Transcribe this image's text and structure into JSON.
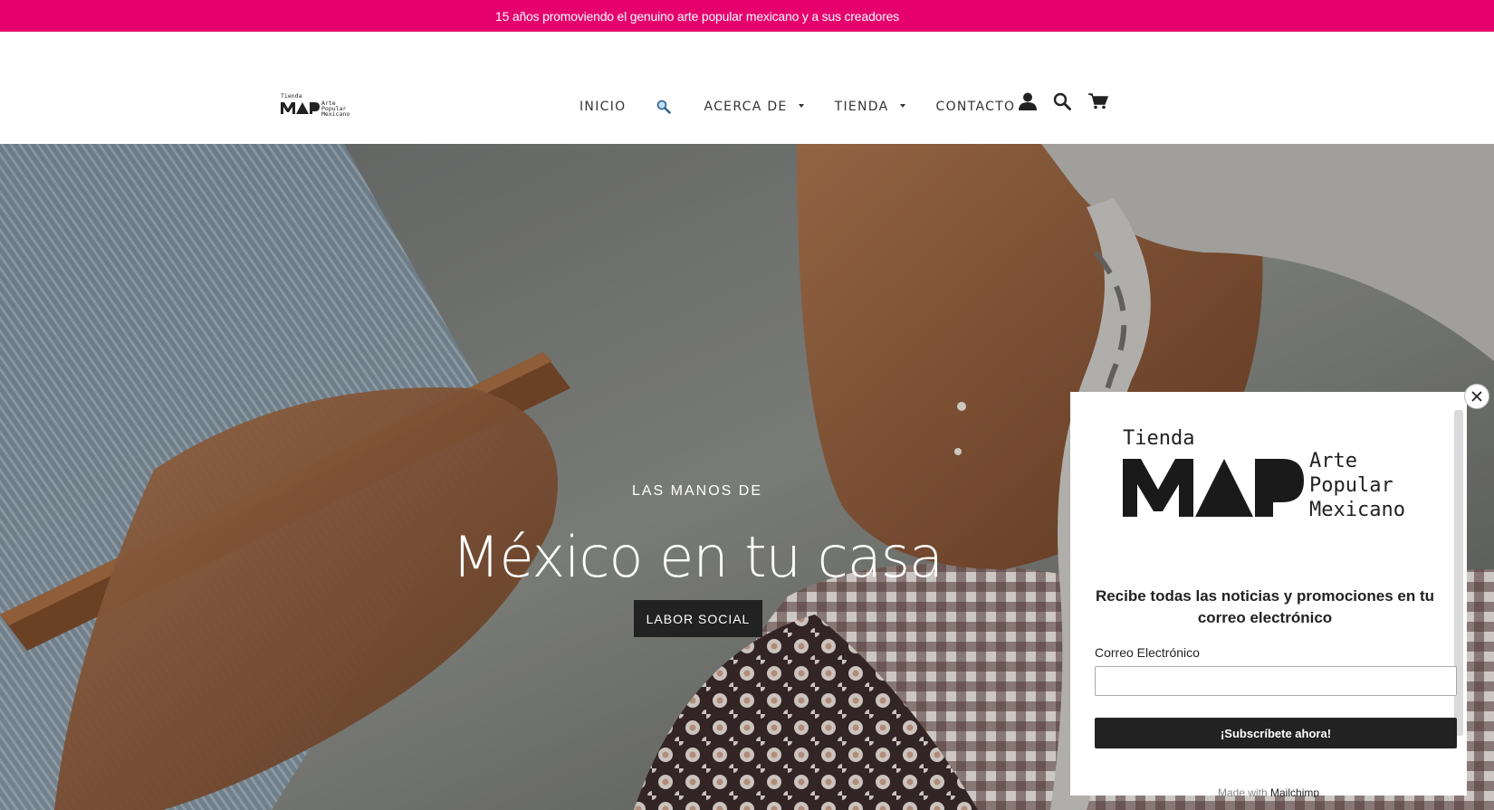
{
  "announcement": {
    "text": "15 años promoviendo el genuino arte popular mexicano y a sus creadores"
  },
  "logo": {
    "tienda": "Tienda",
    "map": "MAP",
    "line1": "Arte",
    "line2": "Popular",
    "line3": "Mexicano"
  },
  "nav": {
    "items": [
      {
        "label": "INICIO"
      },
      {
        "label": "ACERCA DE"
      },
      {
        "label": "TIENDA"
      },
      {
        "label": "CONTACTO"
      }
    ]
  },
  "icons": [
    "magnifier-emoji-icon",
    "account-icon",
    "search-icon",
    "cart-icon",
    "close-icon"
  ],
  "hero": {
    "subheading": "LAS MANOS DE",
    "title": "México en tu casa",
    "button": "LABOR SOCIAL"
  },
  "popup": {
    "heading": "Recibe todas las noticias y promociones en tu correo electrónico",
    "email_label": "Correo Electrónico",
    "email_value": "",
    "submit": "¡Subscríbete ahora!",
    "footer_prefix": "Made with",
    "footer_brand": "Mailchimp"
  },
  "colors": {
    "announcement_bg": "#e6006e",
    "button_bg": "#222222"
  }
}
